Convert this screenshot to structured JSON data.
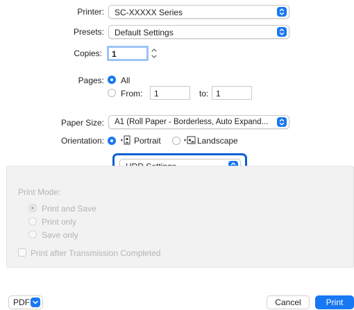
{
  "printer": {
    "label": "Printer:",
    "value": "SC-XXXXX Series"
  },
  "presets": {
    "label": "Presets:",
    "value": "Default Settings"
  },
  "copies": {
    "label": "Copies:",
    "value": "1"
  },
  "pages": {
    "label": "Pages:",
    "all_label": "All",
    "from_label": "From:",
    "from_value": "1",
    "to_label": "to:",
    "to_value": "1"
  },
  "paper_size": {
    "label": "Paper Size:",
    "value": "A1 (Roll Paper - Borderless, Auto Expand..."
  },
  "orientation": {
    "label": "Orientation:",
    "portrait_label": "Portrait",
    "landscape_label": "Landscape"
  },
  "section_popup": {
    "value": "HDD Settings"
  },
  "hdd": {
    "print_mode_label": "Print Mode:",
    "options": [
      "Print and Save",
      "Print only",
      "Save only"
    ],
    "after_transmission_label": "Print after Transmission Completed"
  },
  "footer": {
    "pdf_label": "PDF",
    "cancel_label": "Cancel",
    "print_label": "Print"
  },
  "colors": {
    "accent": "#1877f2",
    "highlight_border": "#0a5fd6"
  },
  "icons": {
    "popup": "chevron-updown-icon",
    "stepper": "stepper-icon",
    "pdf_menu": "chevron-down-icon"
  }
}
